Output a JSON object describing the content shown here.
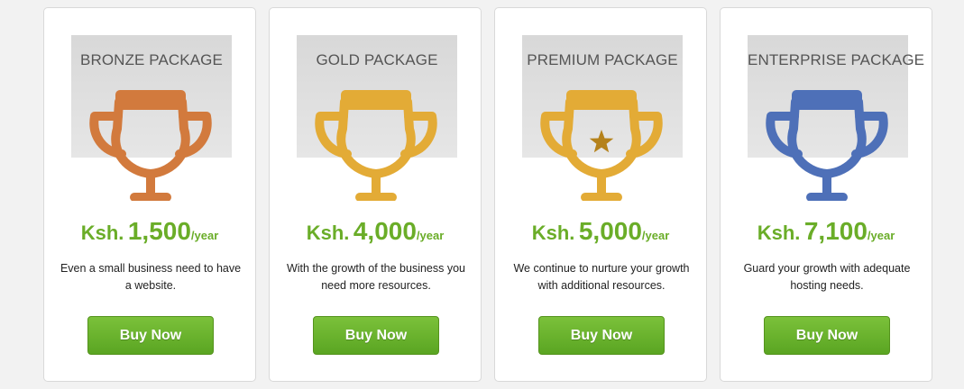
{
  "packages": [
    {
      "title": "BRONZE PACKAGE",
      "icon": "trophy-icon",
      "color": "#d27a3d",
      "star": false,
      "currency": "Ksh.",
      "amount": "1,500",
      "period": "/year",
      "description": "Even a small business need to have a website.",
      "button": "Buy Now"
    },
    {
      "title": "GOLD PACKAGE",
      "icon": "trophy-icon",
      "color": "#e3ab36",
      "star": false,
      "currency": "Ksh.",
      "amount": "4,000",
      "period": "/year",
      "description": "With the growth of the business you need more resources.",
      "button": "Buy Now"
    },
    {
      "title": "PREMIUM PACKAGE",
      "icon": "trophy-star-icon",
      "color": "#e3ab36",
      "star": true,
      "star_color": "#b5821b",
      "currency": "Ksh.",
      "amount": "5,000",
      "period": "/year",
      "description": "We continue to nurture your growth with additional resources.",
      "button": "Buy Now"
    },
    {
      "title": "ENTERPRISE PACKAGE",
      "icon": "trophy-icon",
      "color": "#4e70b8",
      "star": false,
      "currency": "Ksh.",
      "amount": "7,100",
      "period": "/year",
      "description": "Guard your growth with adequate hosting needs.",
      "button": "Buy Now"
    }
  ],
  "theme": {
    "price_color": "#6aad28",
    "button_color": "#5aa522"
  }
}
